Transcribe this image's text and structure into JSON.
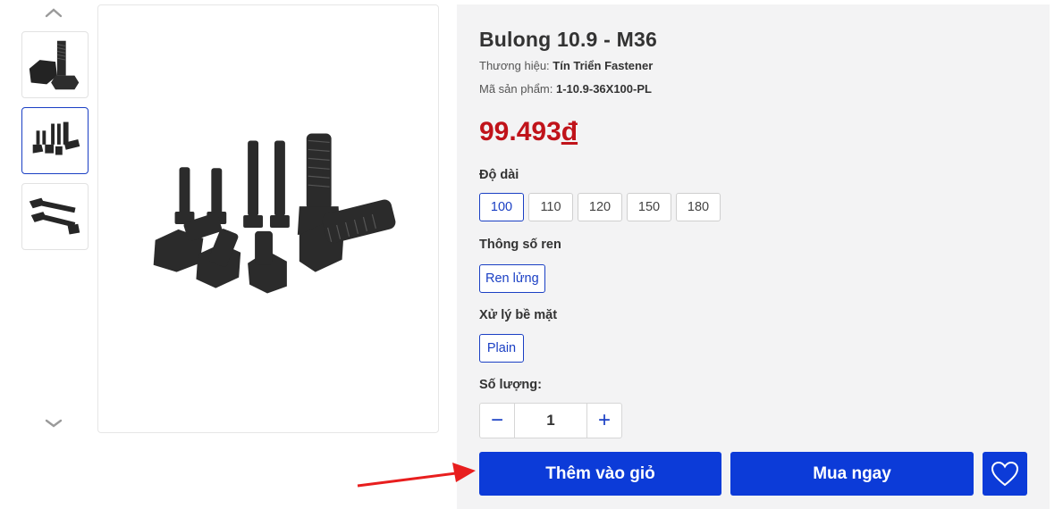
{
  "product": {
    "title": "Bulong 10.9 - M36",
    "brand_label": "Thương hiệu:",
    "brand_value": "Tín Triển Fastener",
    "sku_label": "Mã sản phẩm:",
    "sku_value": "1-10.9-36X100-PL",
    "price_number": "99.493",
    "price_currency": "đ"
  },
  "options": {
    "length": {
      "label": "Độ dài",
      "values": [
        "100",
        "110",
        "120",
        "150",
        "180"
      ],
      "selected": "100"
    },
    "thread": {
      "label": "Thông số ren",
      "values": [
        "Ren lửng"
      ],
      "selected": "Ren lửng"
    },
    "surface": {
      "label": "Xử lý bề mặt",
      "values": [
        "Plain"
      ],
      "selected": "Plain"
    }
  },
  "quantity": {
    "label": "Số lượng:",
    "value": "1",
    "minus": "−",
    "plus": "+"
  },
  "actions": {
    "add_to_cart": "Thêm vào giỏ",
    "buy_now": "Mua ngay"
  },
  "gallery": {
    "active_thumb": 1
  },
  "colors": {
    "accent": "#0c3bd8",
    "price": "#c0131a",
    "panel_bg": "#f3f3f4",
    "arrow": "#e81e1e"
  }
}
